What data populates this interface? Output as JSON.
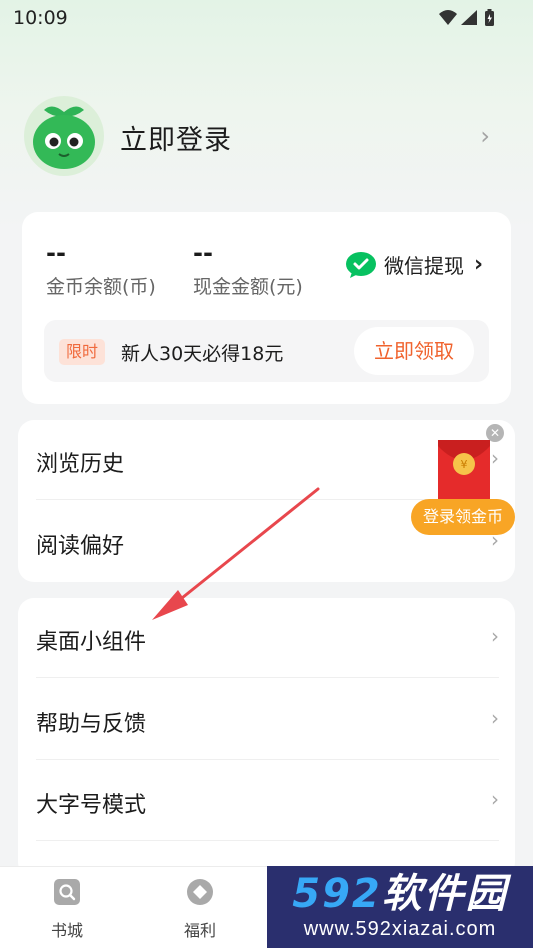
{
  "status_bar": {
    "time": "10:09"
  },
  "profile": {
    "login_label": "立即登录"
  },
  "wallet": {
    "coin_value": "--",
    "coin_label": "金币余额(币)",
    "cash_value": "--",
    "cash_label": "现金金额(元)",
    "wechat_label": "微信提现",
    "promo": {
      "badge": "限时",
      "text": "新人30天必得18元",
      "button": "立即领取"
    }
  },
  "list1": [
    "浏览历史",
    "阅读偏好"
  ],
  "list2": [
    "桌面小组件",
    "帮助与反馈",
    "大字号模式"
  ],
  "floating": {
    "label": "登录领金币",
    "coin_symbol": "¥"
  },
  "tabbar": [
    {
      "label": "书城",
      "icon": "search-book-icon"
    },
    {
      "label": "福利",
      "icon": "diamond-icon"
    }
  ],
  "watermark": {
    "brand_num": "592",
    "brand_cn": "软件园",
    "url": "www.592xiazai.com"
  },
  "colors": {
    "accent_orange": "#f0632e",
    "wechat_green": "#07c160",
    "arrow_red": "#e8474d",
    "watermark_bg": "#2a2f6e"
  }
}
